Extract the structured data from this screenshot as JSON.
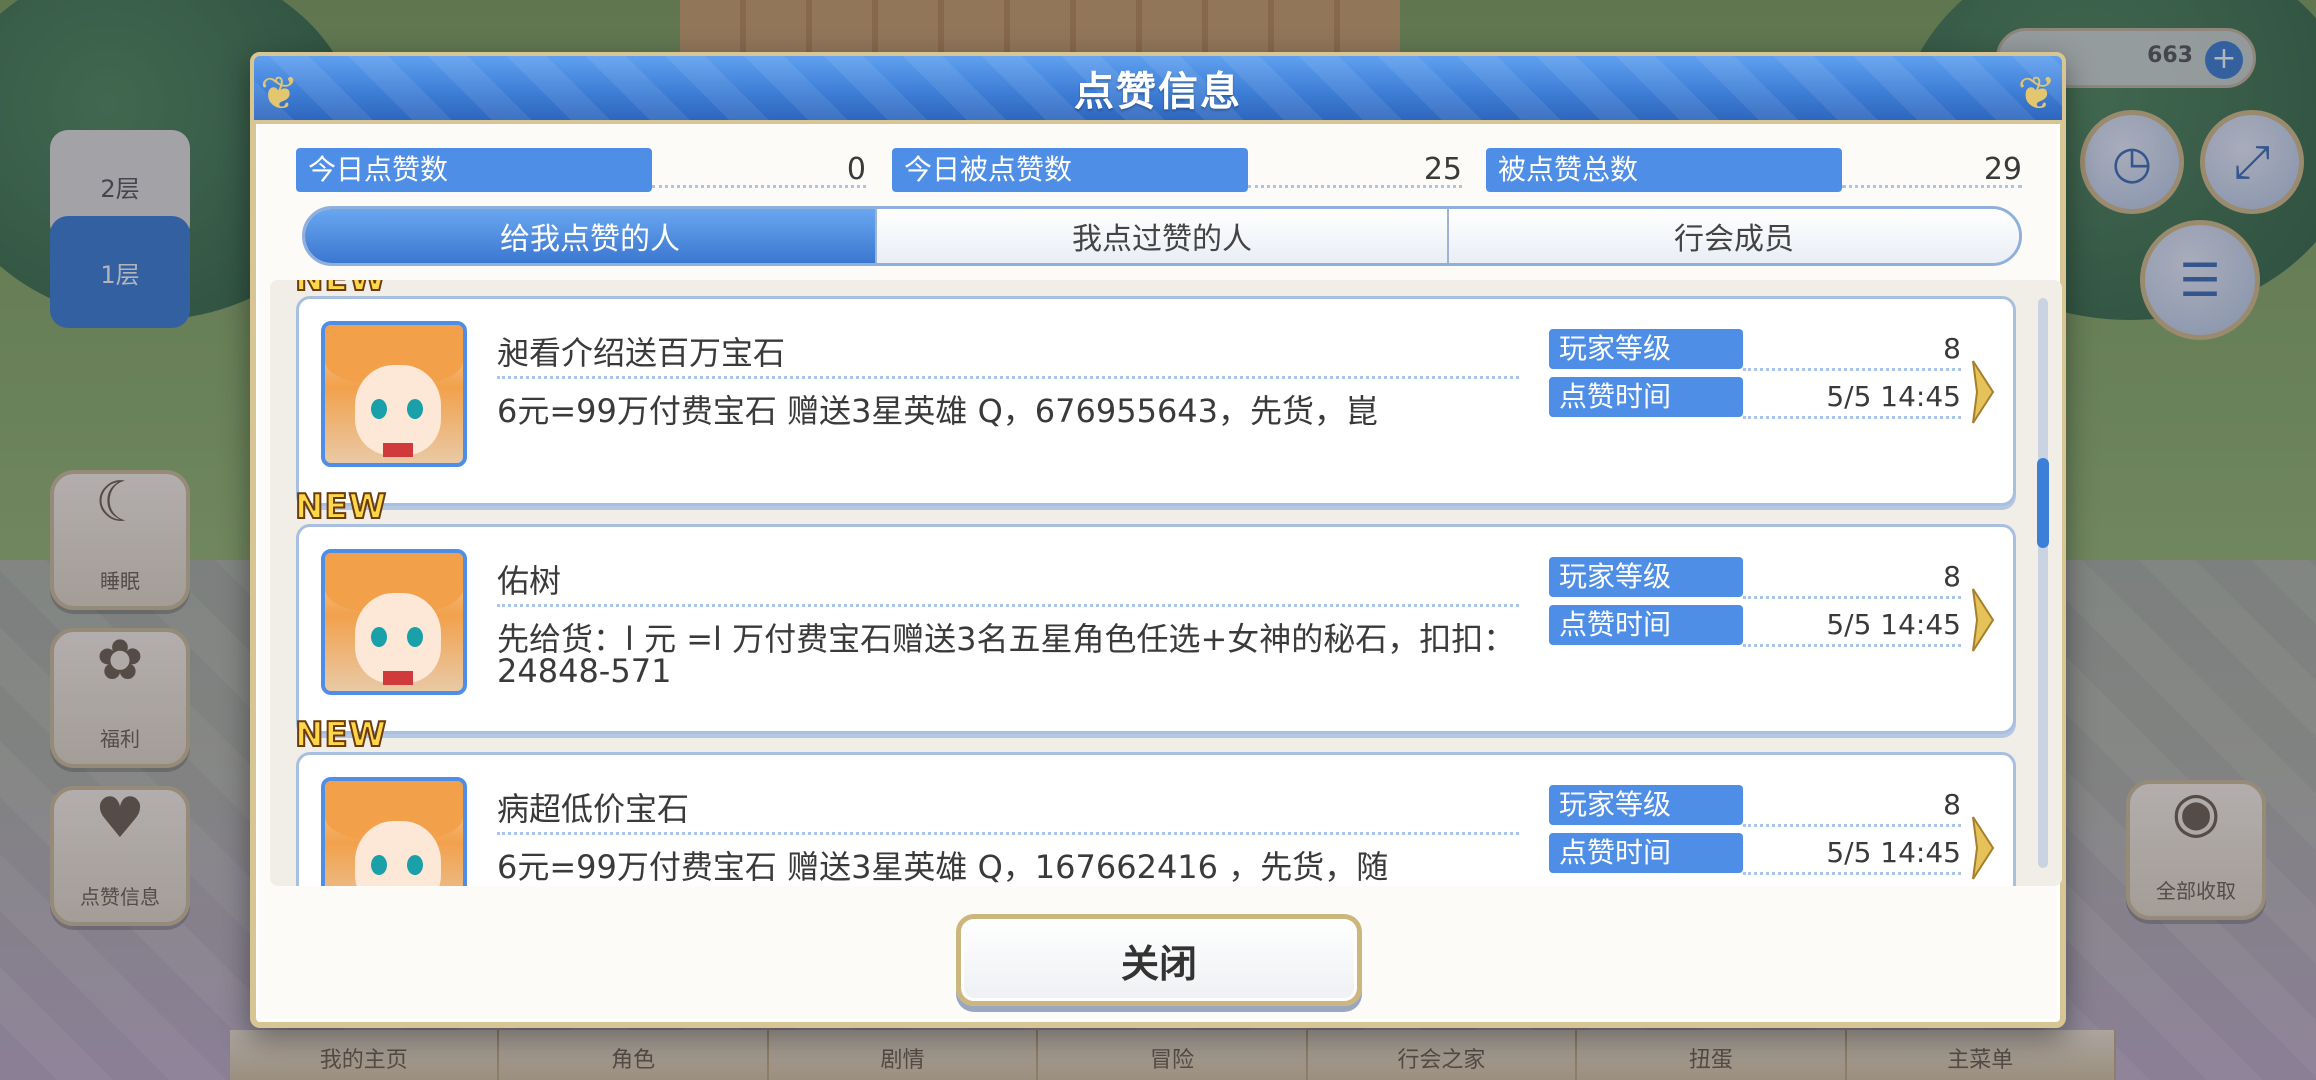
{
  "dialog": {
    "title": "点赞信息",
    "stats": [
      {
        "label": "今日点赞数",
        "value": "0"
      },
      {
        "label": "今日被点赞数",
        "value": "25"
      },
      {
        "label": "被点赞总数",
        "value": "29"
      }
    ],
    "tabs": [
      {
        "label": "给我点赞的人",
        "active": true
      },
      {
        "label": "我点过赞的人",
        "active": false
      },
      {
        "label": "行会成员",
        "active": false
      }
    ],
    "entries": [
      {
        "badge": "NEW",
        "name": "昶看介绍送百万宝石",
        "message": "6元=99万付费宝石 赠送3星英雄 Q，676955643，先货，崑",
        "level_label": "玩家等级",
        "level": "8",
        "time_label": "点赞时间",
        "time": "5/5 14:45"
      },
      {
        "badge": "NEW",
        "name": "佑树",
        "message": "先给货：l 元 =l 万付费宝石赠送3名五星角色任选+女神的秘石，扣扣：24848-571",
        "level_label": "玩家等级",
        "level": "8",
        "time_label": "点赞时间",
        "time": "5/5 14:45"
      },
      {
        "badge": "NEW",
        "name": "病超低价宝石",
        "message": "6元=99万付费宝石 赠送3星英雄 Q，167662416 ，先货，随",
        "level_label": "玩家等级",
        "level": "8",
        "time_label": "点赞时间",
        "time": "5/5 14:45"
      }
    ],
    "close_label": "关闭"
  },
  "background": {
    "floor_tabs": [
      "2层",
      "1层"
    ],
    "side_buttons": [
      "睡眠",
      "福利",
      "点赞信息"
    ],
    "right_button": "全部收取",
    "gem_count": "663",
    "bottom_nav": [
      "我的主页",
      "角色",
      "剧情",
      "冒险",
      "行会之家",
      "扭蛋",
      "主菜单"
    ],
    "menu_label": "MENU"
  },
  "colors": {
    "accent_blue": "#4f8ee6",
    "header_blue": "#3f7fd7",
    "gold_border": "#d8c594",
    "new_badge": "#ffd84a"
  },
  "icons": [
    "avatar-portrait",
    "chevron-right-icon",
    "close-button"
  ]
}
